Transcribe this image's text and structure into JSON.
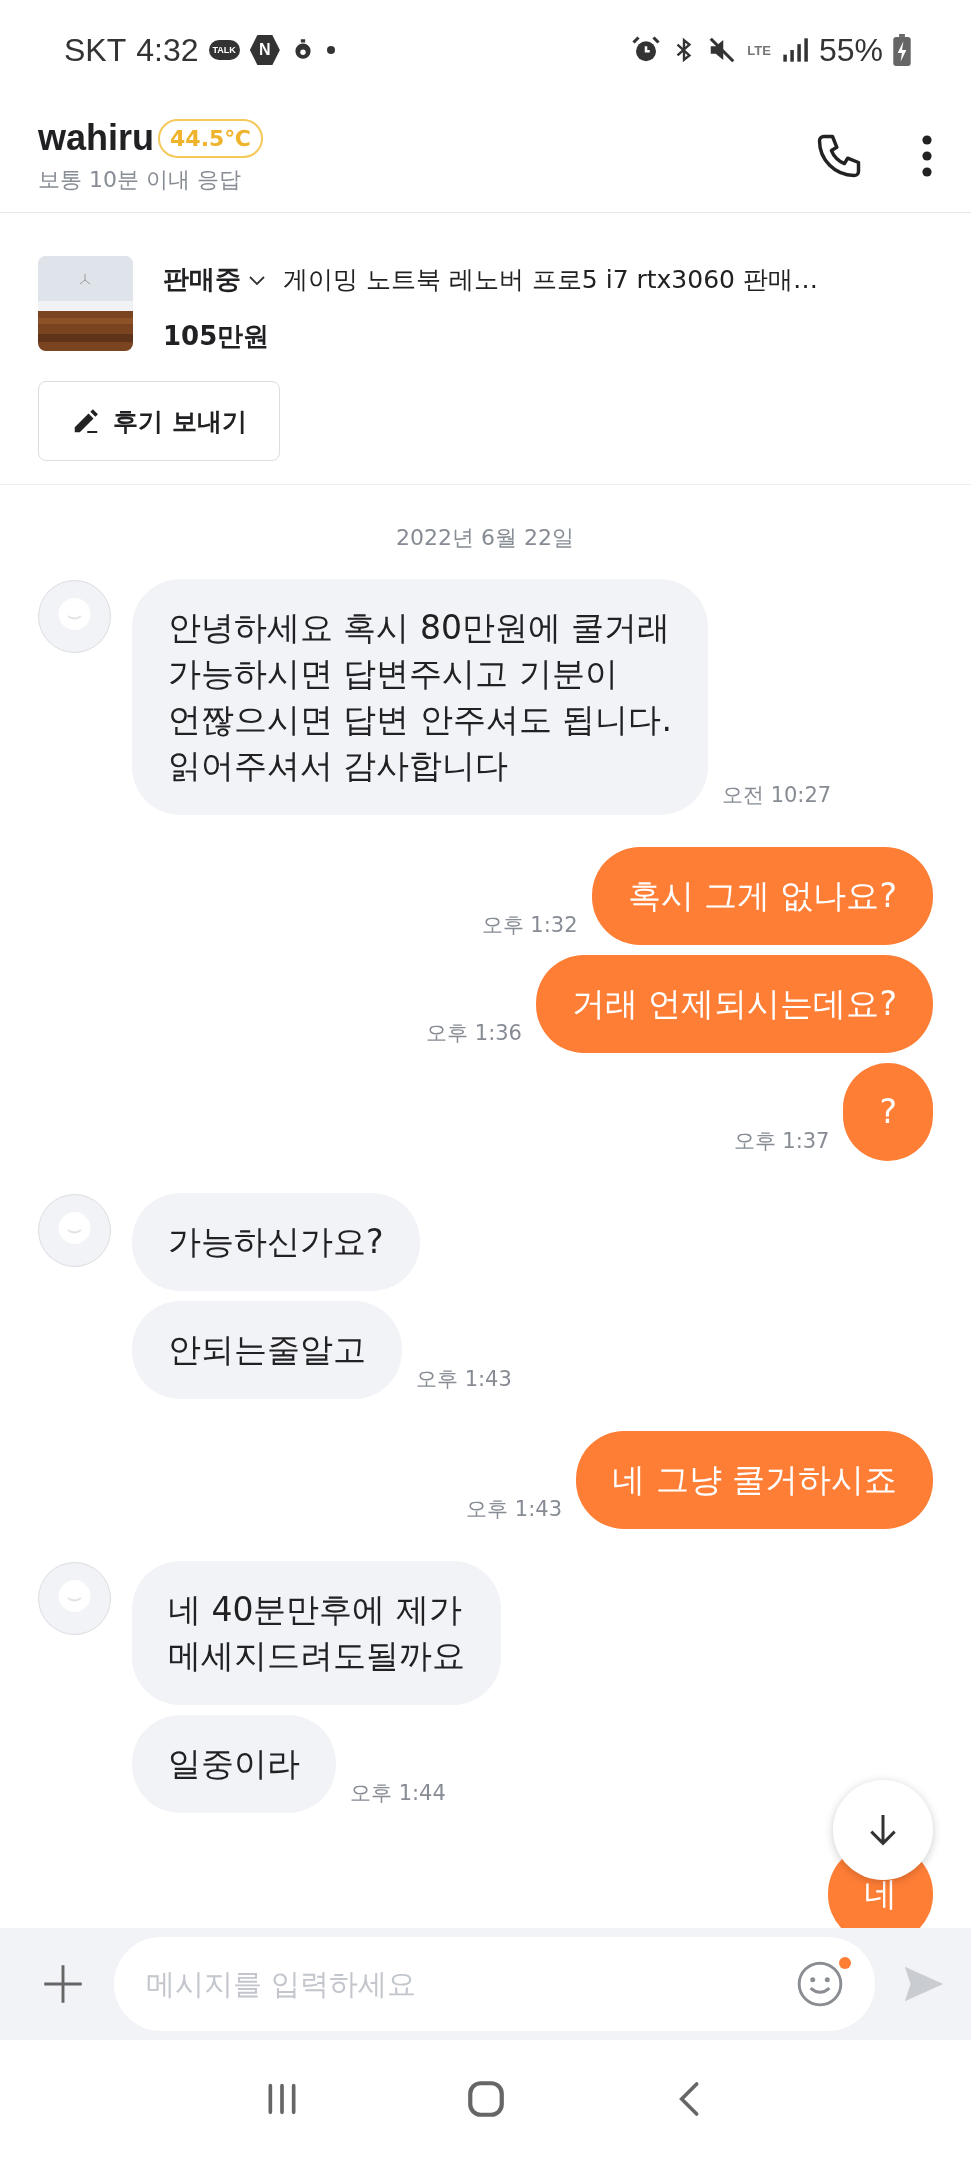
{
  "status_bar": {
    "carrier": "SKT",
    "time": "4:32",
    "talk_badge": "TALK",
    "n_badge": "N",
    "network": "LTE",
    "battery": "55%"
  },
  "header": {
    "name": "wahiru",
    "temperature": "44.5℃",
    "response_time": "보통 10분 이내 응답"
  },
  "product": {
    "status": "판매중",
    "title": "게이밍 노트북 레노버 프로5 i7 rtx3060 판매…",
    "price": "105만원",
    "review_button": "후기 보내기"
  },
  "date": "2022년 6월 22일",
  "messages": [
    {
      "kind": "received",
      "avatar": true,
      "text": "안녕하세요 혹시 80만원에 쿨거래\n가능하시면 답변주시고 기분이\n언짢으시면 답변 안주셔도 됩니다.\n읽어주셔서 감사합니다",
      "time": "오전 10:27"
    },
    {
      "kind": "sent",
      "text": "혹시 그게 없나요?",
      "time": "오후 1:32"
    },
    {
      "kind": "sent",
      "text": "거래 언제되시는데요?",
      "time": "오후 1:36"
    },
    {
      "kind": "sent",
      "text": "?",
      "time": "오후 1:37"
    },
    {
      "kind": "received",
      "avatar": true,
      "text": "가능하신가요?"
    },
    {
      "kind": "received",
      "avatar": false,
      "text": "안되는줄알고",
      "time": "오후 1:43"
    },
    {
      "kind": "sent",
      "text": "네 그냥 쿨거하시죠",
      "time": "오후 1:43"
    },
    {
      "kind": "received",
      "avatar": true,
      "text": "네 40분만후에 제가\n메세지드려도될까요"
    },
    {
      "kind": "received",
      "avatar": false,
      "text": "일중이라",
      "time": "오후 1:44"
    },
    {
      "kind": "sent",
      "text": "네"
    }
  ],
  "input": {
    "placeholder": "메시지를 입력하세요",
    "emoji_notification": true
  }
}
